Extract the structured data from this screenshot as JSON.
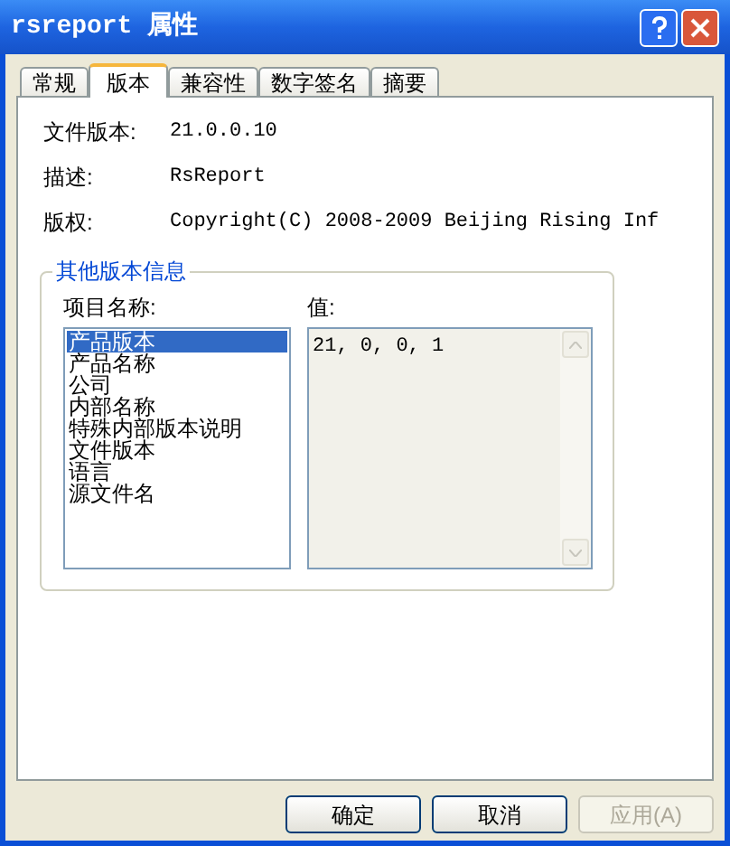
{
  "window": {
    "title": "rsreport 属性"
  },
  "tabs": [
    {
      "label": "常规",
      "selected": false
    },
    {
      "label": "版本",
      "selected": true
    },
    {
      "label": "兼容性",
      "selected": false
    },
    {
      "label": "数字签名",
      "selected": false
    },
    {
      "label": "摘要",
      "selected": false
    }
  ],
  "fields": [
    {
      "label": "文件版本:",
      "value": "21.0.0.10"
    },
    {
      "label": "描述:",
      "value": "RsReport"
    },
    {
      "label": "版权:",
      "value": "Copyright(C) 2008-2009 Beijing Rising Inf"
    }
  ],
  "other_info": {
    "title": "其他版本信息",
    "names_label": "项目名称:",
    "value_label": "值:",
    "items": [
      {
        "label": "产品版本",
        "selected": true
      },
      {
        "label": "产品名称",
        "selected": false
      },
      {
        "label": "公司",
        "selected": false
      },
      {
        "label": "内部名称",
        "selected": false
      },
      {
        "label": "特殊内部版本说明",
        "selected": false
      },
      {
        "label": "文件版本",
        "selected": false
      },
      {
        "label": "语言",
        "selected": false
      },
      {
        "label": "源文件名",
        "selected": false
      }
    ],
    "value": "21, 0, 0, 1"
  },
  "buttons": [
    {
      "label": "确定",
      "disabled": false
    },
    {
      "label": "取消",
      "disabled": false
    },
    {
      "label": "应用(A)",
      "disabled": true
    }
  ]
}
